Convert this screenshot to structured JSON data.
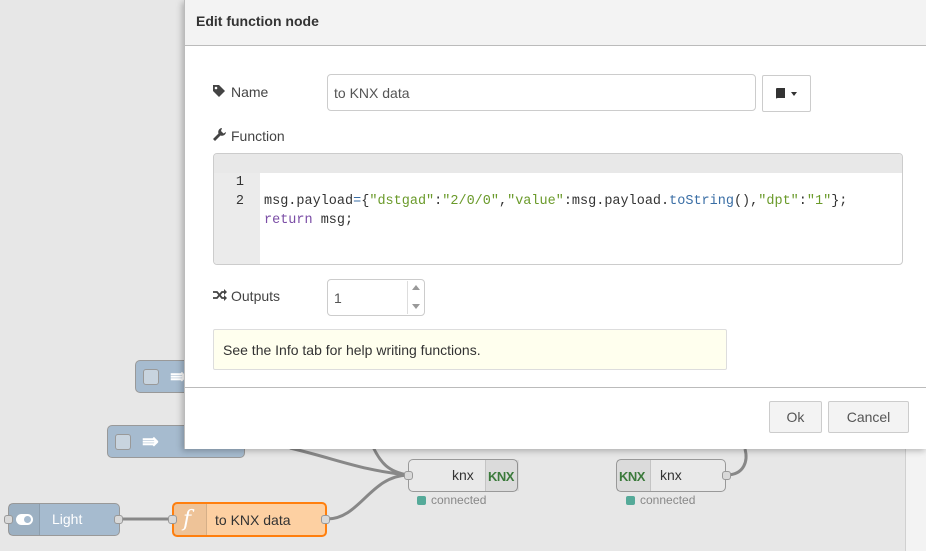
{
  "dialog": {
    "title": "Edit function node",
    "name_label": "Name",
    "name_value": "to KNX data",
    "function_label": "Function",
    "code_lines": [
      {
        "num": "1",
        "text": "msg.payload={\"dstgad\":\"2/0/0\",\"value\":msg.payload.toString(),\"dpt\":\"1\"};"
      },
      {
        "num": "2",
        "text": "return msg;"
      }
    ],
    "outputs_label": "Outputs",
    "outputs_value": "1",
    "tip": "See the Info tab for help writing functions.",
    "ok_label": "Ok",
    "cancel_label": "Cancel",
    "icons": {
      "name": "tag-icon",
      "function": "wrench-icon",
      "outputs": "shuffle-icon",
      "library": "book-icon"
    }
  },
  "flow": {
    "nodes": {
      "light": "Light",
      "function": "to KNX data",
      "knx_1": "knx",
      "knx_2": "knx",
      "knx_logo": "KNX"
    },
    "status": {
      "knx_1": "connected",
      "knx_2": "connected"
    },
    "colors": {
      "function_node": "#fdd0a2",
      "light_node": "#a6bbcf",
      "knx_node": "#e9e9e9",
      "status_connected": "#5a9"
    }
  }
}
